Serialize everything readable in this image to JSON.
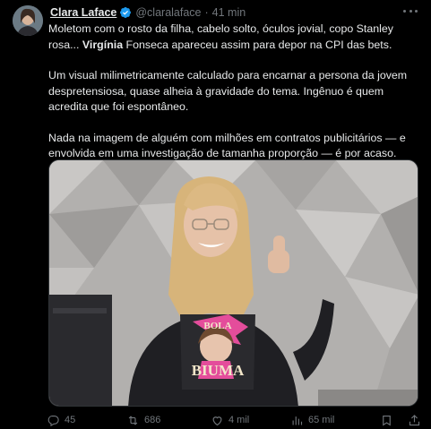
{
  "author": {
    "name": "Clara Laface",
    "handle": "@claralaface",
    "separator": "·",
    "time": "41 min",
    "verified_icon": "verified-badge-icon",
    "verified_color": "#1d9bf0"
  },
  "tweet": {
    "line1_before": "Moletom com o rosto da filha, cabelo solto, óculos jovial, copo Stanley rosa... ",
    "line1_bold": "Virgínia",
    "line1_after": " Fonseca apareceu assim para depor na CPI das bets.",
    "paragraph2": "Um visual milimetricamente calculado para encarnar a persona da jovem despretensiosa, quase alheia à gravidade do tema. Ingênuo é quem acredita que foi espontâneo.",
    "paragraph3": "Nada na imagem de alguém com milhões em contratos publicitários — e envolvida em uma investigação de tamanha proporção — é por acaso."
  },
  "media": {
    "sweatshirt_lettering_top": "BOLA",
    "sweatshirt_lettering_bottom": "BIUMA"
  },
  "actions": {
    "reply_count": "45",
    "retweet_count": "686",
    "like_count": "4 mil",
    "views_count": "65 mil",
    "icon_color": "#71767b"
  }
}
